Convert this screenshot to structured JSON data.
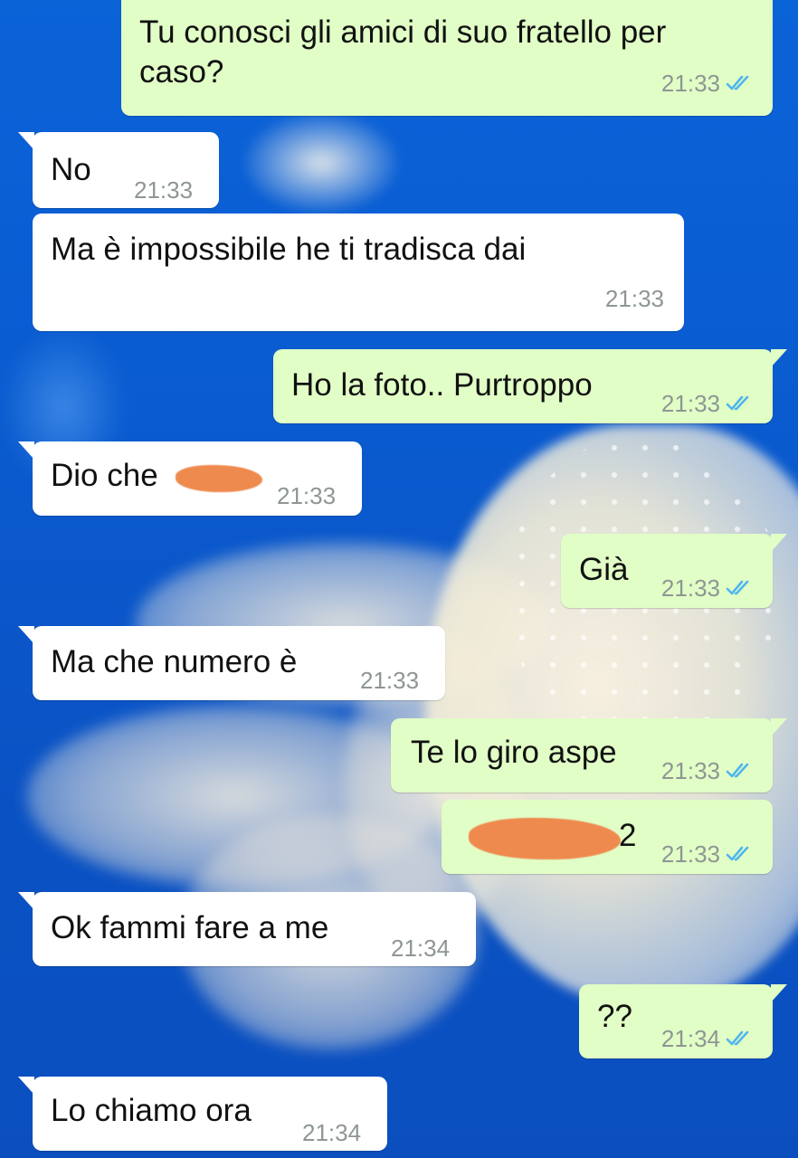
{
  "messages": [
    {
      "direction": "outgoing",
      "lines": [
        "Tu conosci gli amici di suo fratello per",
        "caso?"
      ],
      "time": "21:33",
      "status": "read"
    },
    {
      "direction": "incoming",
      "text": "No",
      "time": "21:33"
    },
    {
      "direction": "incoming",
      "text": "Ma è impossibile he ti tradisca dai",
      "time": "21:33"
    },
    {
      "direction": "outgoing",
      "text": "Ho la foto.. Purtroppo",
      "time": "21:33",
      "status": "read"
    },
    {
      "direction": "incoming",
      "text": "Dio che",
      "redacted": true,
      "time": "21:33"
    },
    {
      "direction": "outgoing",
      "text": "Già",
      "time": "21:33",
      "status": "read"
    },
    {
      "direction": "incoming",
      "text": "Ma che numero è",
      "time": "21:33"
    },
    {
      "direction": "outgoing",
      "text": "Te lo giro aspe",
      "time": "21:33",
      "status": "read"
    },
    {
      "direction": "outgoing",
      "text": "2",
      "redacted": true,
      "time": "21:33",
      "status": "read"
    },
    {
      "direction": "incoming",
      "text": "Ok fammi fare a me",
      "time": "21:34"
    },
    {
      "direction": "outgoing",
      "text": "??",
      "time": "21:34",
      "status": "read"
    },
    {
      "direction": "incoming",
      "text": "Lo chiamo ora",
      "time": "21:34"
    }
  ],
  "colors": {
    "incoming_bubble": "#ffffff",
    "outgoing_bubble": "#e1fec6",
    "read_ticks": "#4fb6ec",
    "timestamp": "#8e9694",
    "redaction": "#ef8a4f",
    "wallpaper": "#0a5bd0"
  },
  "icons": {
    "read_status": "double-check-icon"
  }
}
